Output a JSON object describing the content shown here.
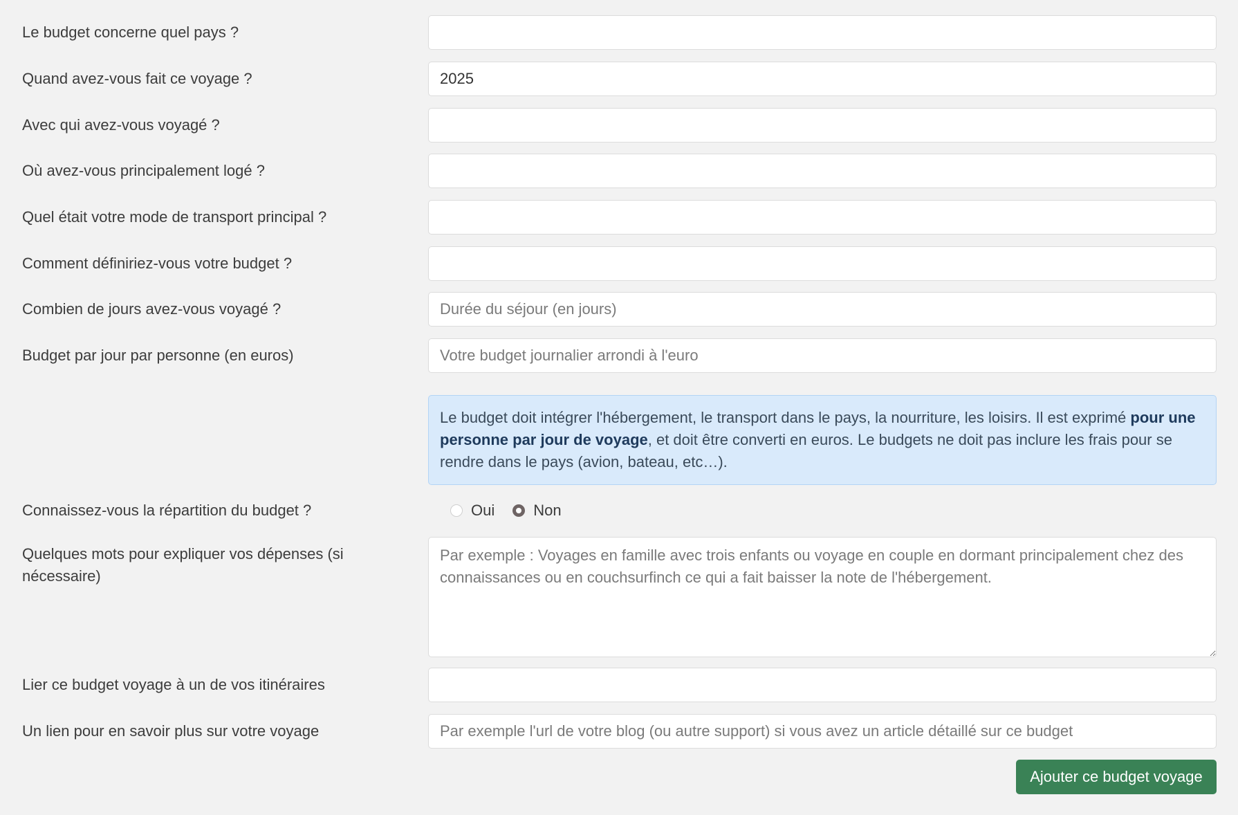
{
  "form": {
    "fields": [
      {
        "label": "Le budget concerne quel pays ?",
        "value": "",
        "placeholder": ""
      },
      {
        "label": "Quand avez-vous fait ce voyage ?",
        "value": "2025",
        "placeholder": ""
      },
      {
        "label": "Avec qui avez-vous voyagé ?",
        "value": "",
        "placeholder": ""
      },
      {
        "label": "Où avez-vous principalement logé ?",
        "value": "",
        "placeholder": ""
      },
      {
        "label": "Quel était votre mode de transport principal ?",
        "value": "",
        "placeholder": ""
      },
      {
        "label": "Comment définiriez-vous votre budget ?",
        "value": "",
        "placeholder": ""
      },
      {
        "label": "Combien de jours avez-vous voyagé ?",
        "value": "",
        "placeholder": "Durée du séjour (en jours)"
      },
      {
        "label": "Budget par jour par personne (en euros)",
        "value": "",
        "placeholder": "Votre budget journalier arrondi à l'euro"
      }
    ],
    "info": {
      "part1": "Le budget doit intégrer l'hébergement, le transport dans le pays, la nourriture, les loisirs. Il est exprimé ",
      "bold": "pour une personne par jour de voyage",
      "part2": ", et doit être converti en euros. Le budgets ne doit pas inclure les frais pour se rendre dans le pays (avion, bateau, etc…)."
    },
    "repartition": {
      "label": "Connaissez-vous la répartition du budget ?",
      "options": [
        "Oui",
        "Non"
      ],
      "selected": "Non"
    },
    "expenses": {
      "label": "Quelques mots pour expliquer vos dépenses (si nécessaire)",
      "placeholder": "Par exemple : Voyages en famille avec trois enfants ou voyage en couple en dormant principalement chez des connaissances ou en couchsurfinch ce qui a fait baisser la note de l'hébergement.",
      "value": ""
    },
    "itinerary": {
      "label": "Lier ce budget voyage à un de vos itinéraires",
      "value": "",
      "placeholder": ""
    },
    "link": {
      "label": "Un lien pour en savoir plus sur votre voyage",
      "value": "",
      "placeholder": "Par exemple l'url de votre blog (ou autre support) si vous avez un article détaillé sur ce budget"
    },
    "submit_label": "Ajouter ce budget voyage"
  },
  "colors": {
    "background": "#f2f2f2",
    "info_background": "#d9eafb",
    "submit_background": "#3a8256"
  }
}
